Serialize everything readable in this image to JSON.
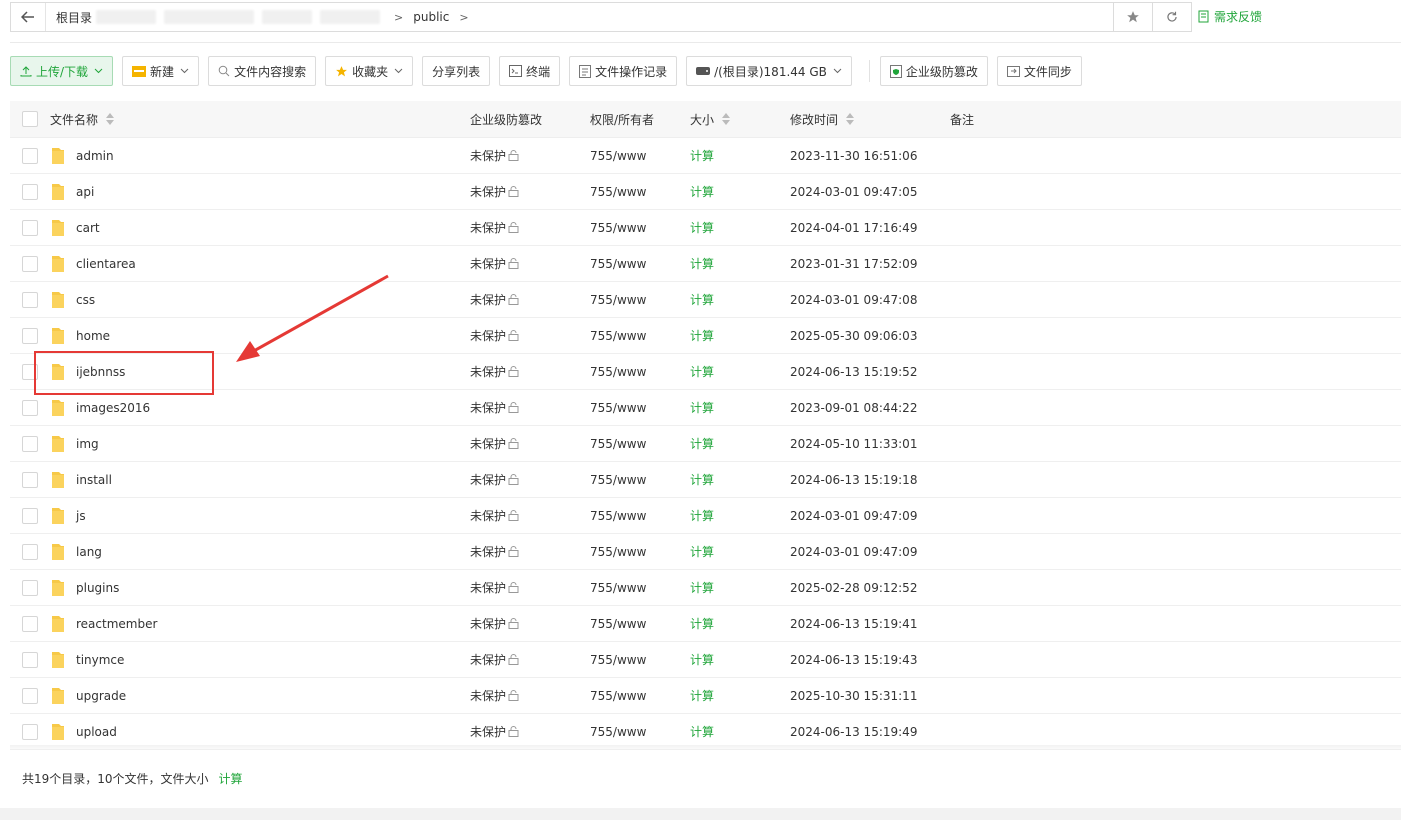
{
  "address_bar": {
    "root_label": "根目录",
    "current_dir": "public"
  },
  "feedback_label": "需求反馈",
  "toolbar": {
    "upload": "上传/下载",
    "new": "新建",
    "content_search": "文件内容搜索",
    "favorites": "收藏夹",
    "share_list": "分享列表",
    "terminal": "终端",
    "op_log": "文件操作记录",
    "disk": "/(根目录)181.44 GB",
    "tamper": "企业级防篡改",
    "sync": "文件同步"
  },
  "table": {
    "headers": {
      "name": "文件名称",
      "protection": "企业级防篡改",
      "perm": "权限/所有者",
      "size": "大小",
      "mtime": "修改时间",
      "note": "备注"
    },
    "rows": [
      {
        "name": "admin",
        "protection": "未保护",
        "perm": "755/www",
        "size": "计算",
        "mtime": "2023-11-30 16:51:06"
      },
      {
        "name": "api",
        "protection": "未保护",
        "perm": "755/www",
        "size": "计算",
        "mtime": "2024-03-01 09:47:05"
      },
      {
        "name": "cart",
        "protection": "未保护",
        "perm": "755/www",
        "size": "计算",
        "mtime": "2024-04-01 17:16:49"
      },
      {
        "name": "clientarea",
        "protection": "未保护",
        "perm": "755/www",
        "size": "计算",
        "mtime": "2023-01-31 17:52:09"
      },
      {
        "name": "css",
        "protection": "未保护",
        "perm": "755/www",
        "size": "计算",
        "mtime": "2024-03-01 09:47:08"
      },
      {
        "name": "home",
        "protection": "未保护",
        "perm": "755/www",
        "size": "计算",
        "mtime": "2025-05-30 09:06:03"
      },
      {
        "name": "ijebnnss",
        "protection": "未保护",
        "perm": "755/www",
        "size": "计算",
        "mtime": "2024-06-13 15:19:52"
      },
      {
        "name": "images2016",
        "protection": "未保护",
        "perm": "755/www",
        "size": "计算",
        "mtime": "2023-09-01 08:44:22"
      },
      {
        "name": "img",
        "protection": "未保护",
        "perm": "755/www",
        "size": "计算",
        "mtime": "2024-05-10 11:33:01"
      },
      {
        "name": "install",
        "protection": "未保护",
        "perm": "755/www",
        "size": "计算",
        "mtime": "2024-06-13 15:19:18"
      },
      {
        "name": "js",
        "protection": "未保护",
        "perm": "755/www",
        "size": "计算",
        "mtime": "2024-03-01 09:47:09"
      },
      {
        "name": "lang",
        "protection": "未保护",
        "perm": "755/www",
        "size": "计算",
        "mtime": "2024-03-01 09:47:09"
      },
      {
        "name": "plugins",
        "protection": "未保护",
        "perm": "755/www",
        "size": "计算",
        "mtime": "2025-02-28 09:12:52"
      },
      {
        "name": "reactmember",
        "protection": "未保护",
        "perm": "755/www",
        "size": "计算",
        "mtime": "2024-06-13 15:19:41"
      },
      {
        "name": "tinymce",
        "protection": "未保护",
        "perm": "755/www",
        "size": "计算",
        "mtime": "2024-06-13 15:19:43"
      },
      {
        "name": "upgrade",
        "protection": "未保护",
        "perm": "755/www",
        "size": "计算",
        "mtime": "2025-10-30 15:31:11"
      },
      {
        "name": "upload",
        "protection": "未保护",
        "perm": "755/www",
        "size": "计算",
        "mtime": "2024-06-13 15:19:49"
      }
    ]
  },
  "footer": {
    "summary": "共19个目录，10个文件，文件大小",
    "calc": "计算"
  },
  "colors": {
    "accent": "#20a53a",
    "folder": "#f7c948",
    "annotation": "#e53935"
  }
}
